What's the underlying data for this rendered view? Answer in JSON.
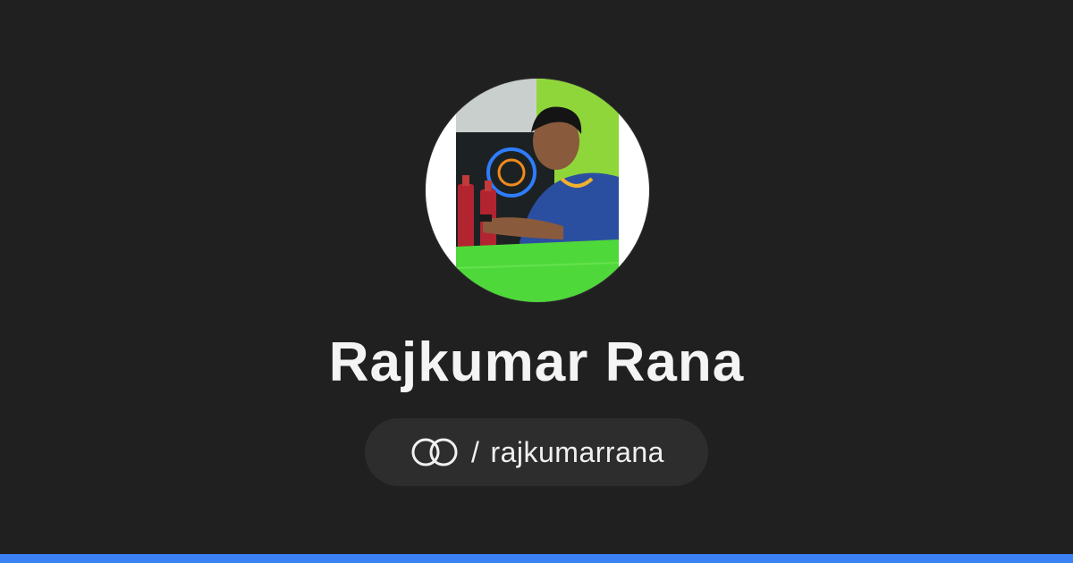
{
  "profile": {
    "name": "Rajkumar Rana",
    "separator": "/",
    "handle": "rajkumarrana",
    "link_icon": "linked-rings-icon",
    "avatar": "profile-photo"
  },
  "colors": {
    "background": "#202020",
    "pill": "#2d2d2d",
    "text": "#f4f4f4",
    "accent_bar": "#3b82f6",
    "avatar_ring": "#ffffff"
  }
}
